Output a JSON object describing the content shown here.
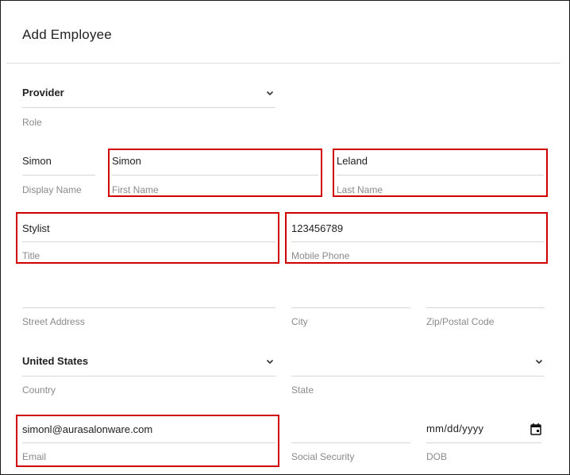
{
  "dialog": {
    "title": "Add Employee"
  },
  "form": {
    "role": {
      "value": "Provider",
      "label": "Role"
    },
    "display_name": {
      "value": "Simon",
      "label": "Display Name"
    },
    "first_name": {
      "value": "Simon",
      "label": "First Name"
    },
    "last_name": {
      "value": "Leland",
      "label": "Last Name"
    },
    "title": {
      "value": "Stylist",
      "label": "Title"
    },
    "mobile_phone": {
      "value": "123456789",
      "label": "Mobile Phone"
    },
    "street_address": {
      "value": "",
      "label": "Street Address"
    },
    "city": {
      "value": "",
      "label": "City"
    },
    "zip": {
      "value": "",
      "label": "Zip/Postal Code"
    },
    "country": {
      "value": "United States",
      "label": "Country"
    },
    "state": {
      "value": "",
      "label": "State"
    },
    "email": {
      "value": "simonl@aurasalonware.com",
      "label": "Email"
    },
    "ssn": {
      "value": "",
      "label": "Social Security"
    },
    "dob": {
      "value": "mm/dd/yyyy",
      "label": "DOB"
    }
  },
  "icons": {
    "dropdown": "chevron-down-icon",
    "date": "calendar-icon"
  },
  "colors": {
    "highlight": "#d00000",
    "label": "#8a8a8a",
    "line": "#d6d6d6"
  }
}
